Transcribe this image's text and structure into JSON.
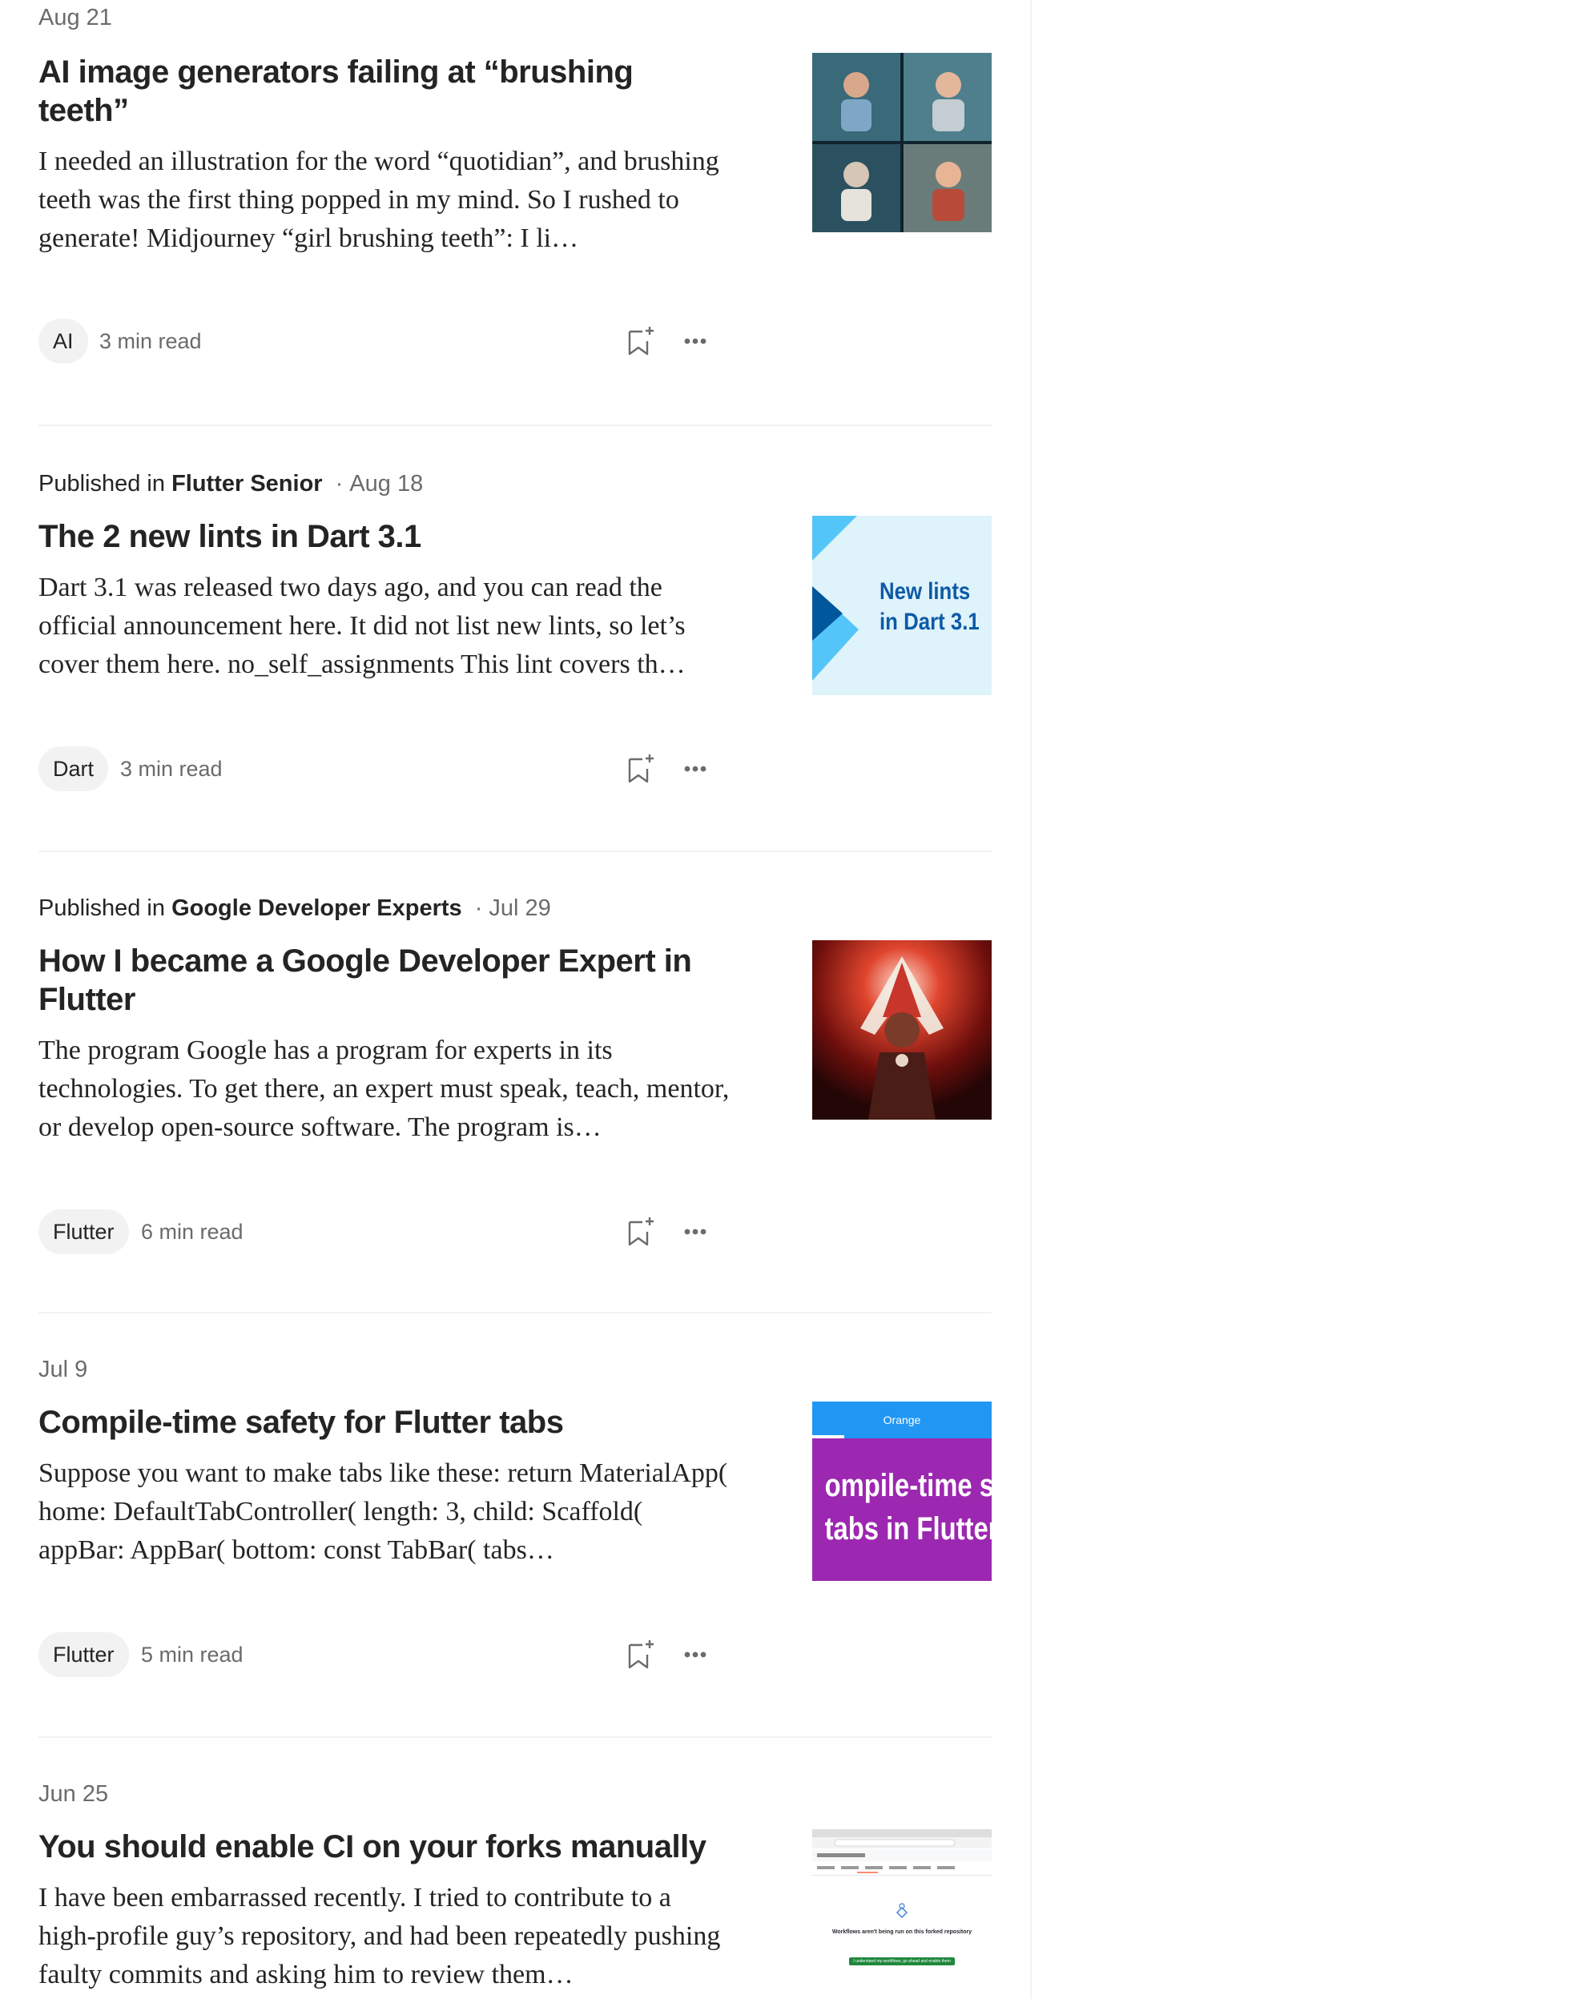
{
  "articles": [
    {
      "publication_prefix": "",
      "publication": "",
      "date": "Aug 21",
      "title": "AI image generators failing at “brushing teeth”",
      "excerpt": "I needed an illustration for the word “quotidian”, and brushing teeth was the first thing popped in my mind. So I rushed to generate! Midjourney “girl brushing teeth”: I li…",
      "tag": "AI",
      "read_time": "3 min read"
    },
    {
      "publication_prefix": "Published in",
      "publication": "Flutter Senior",
      "date": "Aug 18",
      "title": "The 2 new lints in Dart 3.1",
      "excerpt": "Dart 3.1 was released two days ago, and you can read the official announcement here. It did not list new lints, so let’s cover them here. no_self_assignments This lint covers th…",
      "tag": "Dart",
      "read_time": "3 min read",
      "thumb_text_1": "New lints",
      "thumb_text_2": "in Dart 3.1"
    },
    {
      "publication_prefix": "Published in",
      "publication": "Google Developer Experts",
      "date": "Jul 29",
      "title": "How I became a Google Developer Expert in Flutter",
      "excerpt": "The program Google has a program for experts in its technologies. To get there, an expert must speak, teach, mentor, or develop open-source software. The program is…",
      "tag": "Flutter",
      "read_time": "6 min read"
    },
    {
      "publication_prefix": "",
      "publication": "",
      "date": "Jul 9",
      "title": "Compile-time safety for Flutter tabs",
      "excerpt": "Suppose you want to make tabs like these: return MaterialApp( home: DefaultTabController( length: 3, child: Scaffold( appBar: AppBar( bottom: const TabBar( tabs…",
      "tag": "Flutter",
      "read_time": "5 min read",
      "thumb_tab": "Orange",
      "thumb_text_1": "ompile-time saf",
      "thumb_text_2": "tabs in Flutter"
    },
    {
      "publication_prefix": "",
      "publication": "",
      "date": "Jun 25",
      "title": "You should enable CI on your forks manually",
      "excerpt": "I have been embarrassed recently. I tried to contribute to a high-profile guy’s repository, and had been repeatedly pushing faulty commits and asking him to review them…",
      "thumb_heading": "Workflows aren't being run on this forked repository",
      "thumb_button": "I understand my workflows, go ahead and enable them"
    }
  ],
  "colors": {
    "text_primary": "#242424",
    "text_secondary": "#6b6b6b",
    "chip_bg": "#f2f2f2",
    "divider": "#f2f2f2",
    "dart_thumb_bg": "#dff3fb",
    "dart_thumb_text": "#0d5aa7",
    "tabs_thumb_bar": "#2196f3",
    "tabs_thumb_bg": "#9c27b0"
  },
  "icons": {
    "save": "bookmark-plus-icon",
    "more": "more-horizontal-icon"
  }
}
